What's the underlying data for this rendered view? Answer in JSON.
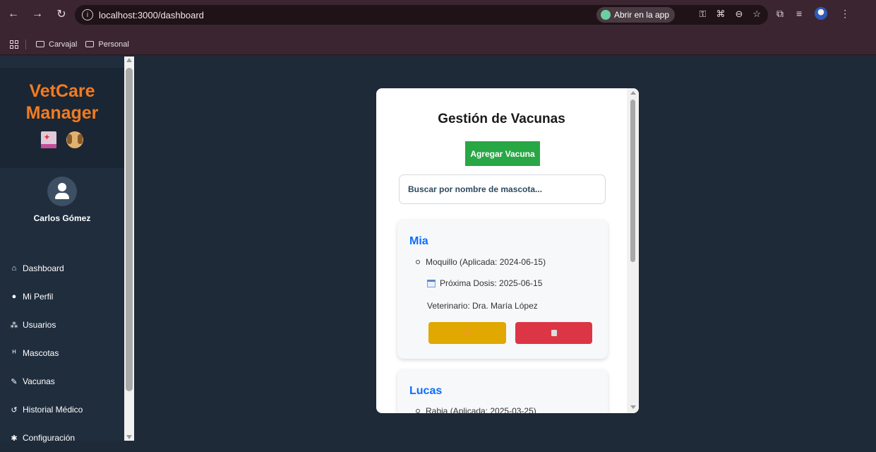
{
  "browser": {
    "url": "localhost:3000/dashboard",
    "open_app_label": "Abrir en la app",
    "bookmarks": [
      "Carvajal",
      "Personal"
    ]
  },
  "sidebar": {
    "brand_line1": "VetCare",
    "brand_line2": "Manager",
    "user_name": "Carlos Gómez",
    "items": [
      {
        "icon": "home-icon",
        "label": "Dashboard"
      },
      {
        "icon": "user-icon",
        "label": "Mi Perfil"
      },
      {
        "icon": "users-icon",
        "label": "Usuarios"
      },
      {
        "icon": "dog-icon",
        "label": "Mascotas"
      },
      {
        "icon": "syringe-icon",
        "label": "Vacunas"
      },
      {
        "icon": "history-icon",
        "label": "Historial Médico"
      },
      {
        "icon": "gear-icon",
        "label": "Configuración"
      }
    ]
  },
  "modal": {
    "title": "Gestión de Vacunas",
    "add_label": "Agregar Vacuna",
    "search_placeholder": "Buscar por nombre de mascota...",
    "cards": [
      {
        "pet": "Mia",
        "vaccine": "Moquillo (Aplicada: 2024-06-15)",
        "next_dose": "Próxima Dosis: 2025-06-15",
        "vet": "Veterinario: Dra. María López"
      },
      {
        "pet": "Lucas",
        "vaccine": "Rabia (Aplicada: 2025-03-25)"
      }
    ]
  },
  "colors": {
    "brand": "#f37b20",
    "sidebar_bg": "#1f2d3d",
    "main_bg": "#1e2a38",
    "add_button": "#28a745",
    "edit_button": "#e0a800",
    "delete_button": "#dc3545",
    "pet_name": "#0d6efd"
  }
}
